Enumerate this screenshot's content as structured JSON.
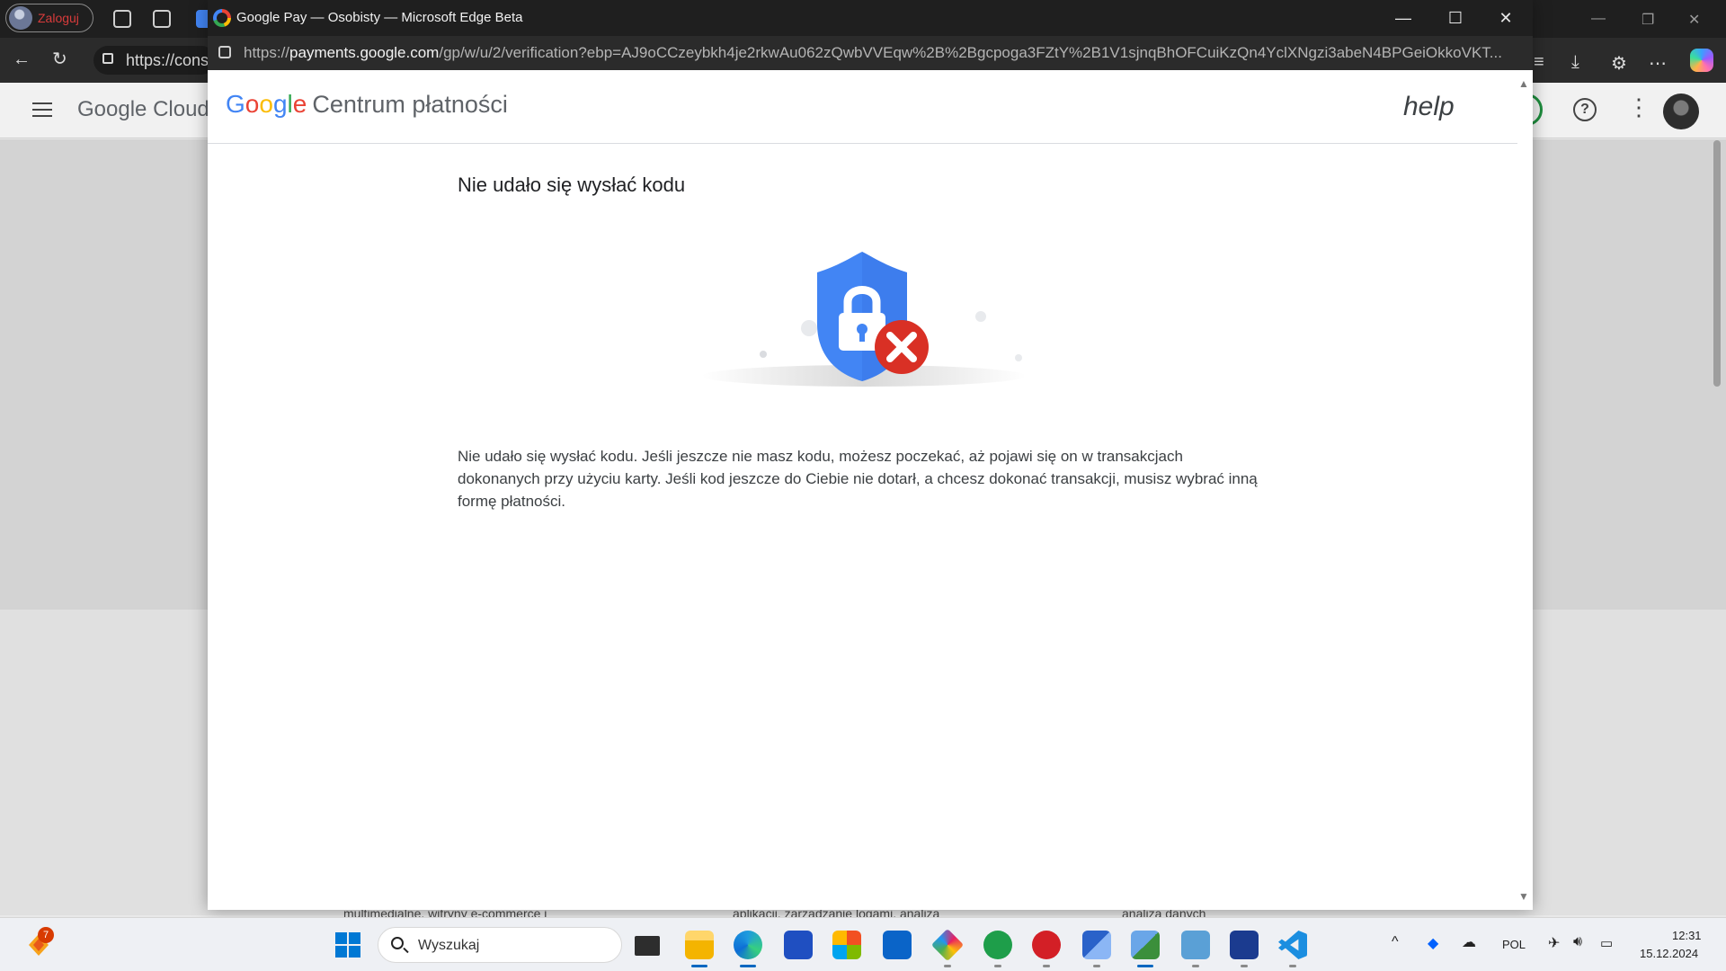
{
  "background_browser": {
    "profile_label": "Zaloguj",
    "url_fragment": "https://cons",
    "gc_logo_google": "Google",
    "gc_logo_cloud": "Cloud",
    "help_glyph": "?",
    "body_fragments": [
      "multimedialne, witryny e-commerce i",
      "aplikacji, zarządzanie logami, analiza",
      "analiza danych"
    ]
  },
  "popup": {
    "window_title": "Google Pay — Osobisty — Microsoft Edge Beta",
    "url_prefix": "https://",
    "url_domain": "payments.google.com",
    "url_path": "/gp/w/u/2/verification?ebp=AJ9oCCzeybkh4je2rkwAu062zQwbVVEqw%2B%2Bgcpoga3FZtY%2B1V1sjnqBhOFCuiKzQn4YclXNgzi3abeN4BPGeiOkkoVKT...",
    "controls": {
      "minimize": "—",
      "maximize": "☐",
      "close": "✕"
    }
  },
  "payments": {
    "logo_google": "Google",
    "logo_product": "Centrum płatności",
    "help_label": "help",
    "heading": "Nie udało się wysłać kodu",
    "message": "Nie udało się wysłać kodu. Jeśli jeszcze nie masz kodu, możesz poczekać, aż pojawi się on w transakcjach dokonanych przy użyciu karty. Jeśli kod jeszcze do Ciebie nie dotarł, a chcesz dokonać transakcji, musisz wybrać inną formę płatności.",
    "illustration": "shield-lock-error-icon"
  },
  "taskbar": {
    "notification_count": "7",
    "search_placeholder": "Wyszukaj",
    "language": "POL",
    "time": "12:31",
    "date": "15.12.2024",
    "apps": [
      "windows-start",
      "task-view",
      "file-explorer",
      "microsoft-edge",
      "save-app",
      "microsoft-store",
      "outlook",
      "git-app",
      "xbox-app",
      "red-app",
      "network-app",
      "remote-app",
      "control-panel",
      "font-app",
      "vs-code"
    ]
  },
  "colors": {
    "google_blue": "#4285f4",
    "google_red": "#ea4335",
    "google_yellow": "#fbbc05",
    "google_green": "#34a853",
    "error_red": "#d93025",
    "titlebar": "#1f1f1f"
  }
}
